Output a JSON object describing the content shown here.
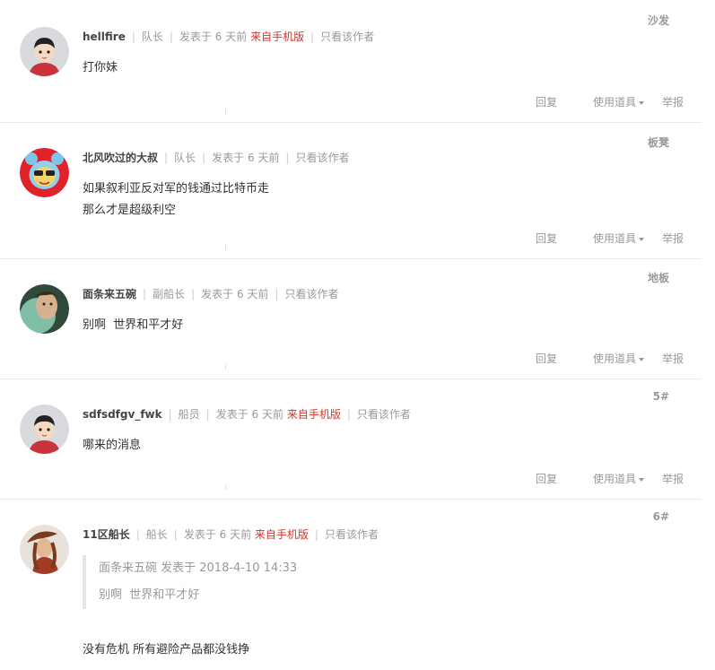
{
  "posts": [
    {
      "floor": "沙发",
      "author": "hellfire",
      "role": "队长",
      "time": "发表于 6 天前",
      "mobile": "来自手机版",
      "only_author": "只看该作者",
      "content": [
        "打你妹"
      ],
      "avatar": "default-avatar"
    },
    {
      "floor": "板凳",
      "author": "北风吹过的大叔",
      "role": "队长",
      "time": "发表于 6 天前",
      "mobile": "",
      "only_author": "只看该作者",
      "content": [
        "如果叙利亚反对军的钱通过比特币走",
        "那么才是超级利空"
      ],
      "avatar": "bear-avatar"
    },
    {
      "floor": "地板",
      "author": "面条来五碗",
      "role": "副船长",
      "time": "发表于 6 天前",
      "mobile": "",
      "only_author": "只看该作者",
      "content": [
        "别啊  世界和平才好"
      ],
      "avatar": "photo-avatar"
    },
    {
      "floor": "5#",
      "author": "sdfsdfgv_fwk",
      "role": "船员",
      "time": "发表于 6 天前",
      "mobile": "来自手机版",
      "only_author": "只看该作者",
      "content": [
        "哪来的消息"
      ],
      "avatar": "default-avatar"
    },
    {
      "floor": "6#",
      "author": "11区船长",
      "role": "船长",
      "time": "发表于 6 天前",
      "mobile": "来自手机版",
      "only_author": "只看该作者",
      "quote_header": "面条来五碗 发表于 2018-4-10 14:33",
      "quote_body": "别啊  世界和平才好",
      "content": [
        "没有危机 所有避险产品都没钱挣"
      ],
      "avatar": "art-avatar"
    }
  ],
  "actions": {
    "reply": "回复",
    "use_item": "使用道具",
    "report": "举报"
  },
  "colors": {
    "mobile": "#d0342c",
    "meta": "#999999",
    "divider": "#ebebeb"
  }
}
